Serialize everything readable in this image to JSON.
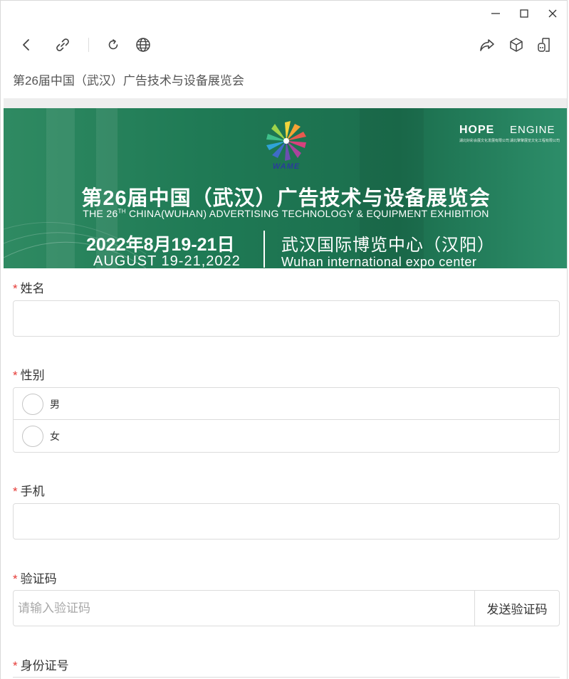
{
  "window": {
    "controls": [
      "minimize-icon",
      "maximize-icon",
      "close-icon"
    ]
  },
  "toolbar": {
    "left_icons": [
      "back-icon",
      "link-icon",
      "refresh-icon",
      "globe-icon"
    ],
    "right_icons": [
      "share-icon",
      "cube-icon",
      "device-icon"
    ]
  },
  "page": {
    "title": "第26届中国（武汉）广告技术与设备展览会"
  },
  "banner": {
    "logo_text": "WAME",
    "partner1": "HOPE",
    "partner1_sub": "湖北好彩会展文化发展有限公司",
    "partner2": "ENGINE",
    "partner2_sub": "湖北擎擎展览文化工程有限公司",
    "title": "第26届中国（武汉）广告技术与设备展览会",
    "subtitle_pre": "THE 26",
    "subtitle_sup": "TH",
    "subtitle_post": " CHINA(WUHAN) ADVERTISING TECHNOLOGY & EQUIPMENT EXHIBITION",
    "date_cn": "2022年8月19-21日",
    "date_en": "AUGUST 19-21,2022",
    "venue_cn": "武汉国际博览中心（汉阳）",
    "venue_en": "Wuhan international expo center"
  },
  "form": {
    "required_mark": "*",
    "name_label": "姓名",
    "gender_label": "性别",
    "gender_options": [
      "男",
      "女"
    ],
    "phone_label": "手机",
    "code_label": "验证码",
    "code_placeholder": "请输入验证码",
    "send_code_label": "发送验证码",
    "id_label": "身份证号"
  },
  "colors": {
    "required": "#e53935",
    "banner_green": "#1f7a55"
  }
}
